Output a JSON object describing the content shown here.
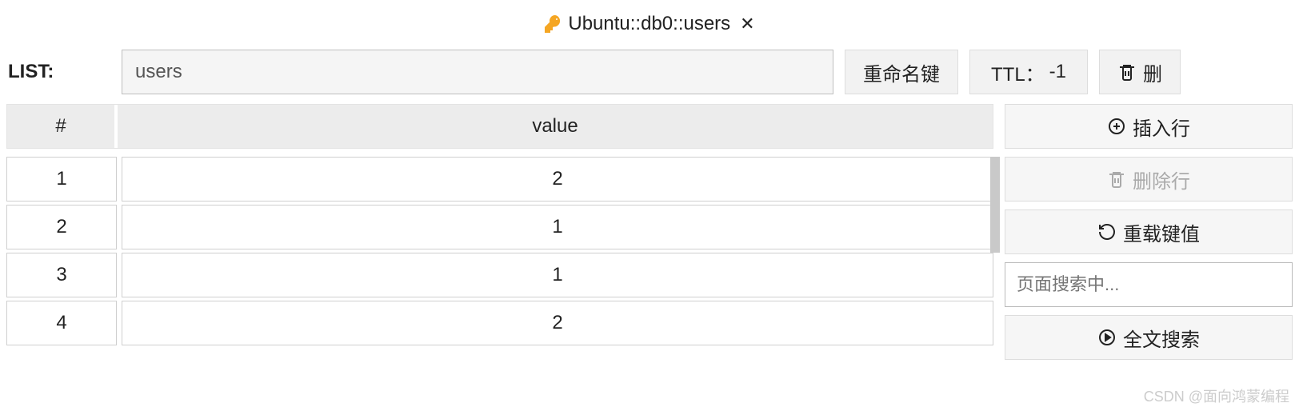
{
  "tab": {
    "title": "Ubuntu::db0::users"
  },
  "toolbar": {
    "type_label": "LIST:",
    "key_value": "users",
    "rename_label": "重命名键",
    "ttl_prefix": "TTL：",
    "ttl_value": "-1",
    "delete_label": "删"
  },
  "table": {
    "header_index": "#",
    "header_value": "value",
    "rows": [
      {
        "index": "1",
        "value": "2"
      },
      {
        "index": "2",
        "value": "1"
      },
      {
        "index": "3",
        "value": "1"
      },
      {
        "index": "4",
        "value": "2"
      }
    ]
  },
  "side": {
    "insert_label": "插入行",
    "delete_row_label": "删除行",
    "reload_label": "重载键值",
    "search_placeholder": "页面搜索中...",
    "fulltext_label": "全文搜索"
  },
  "watermark": "CSDN @面向鸿蒙编程"
}
